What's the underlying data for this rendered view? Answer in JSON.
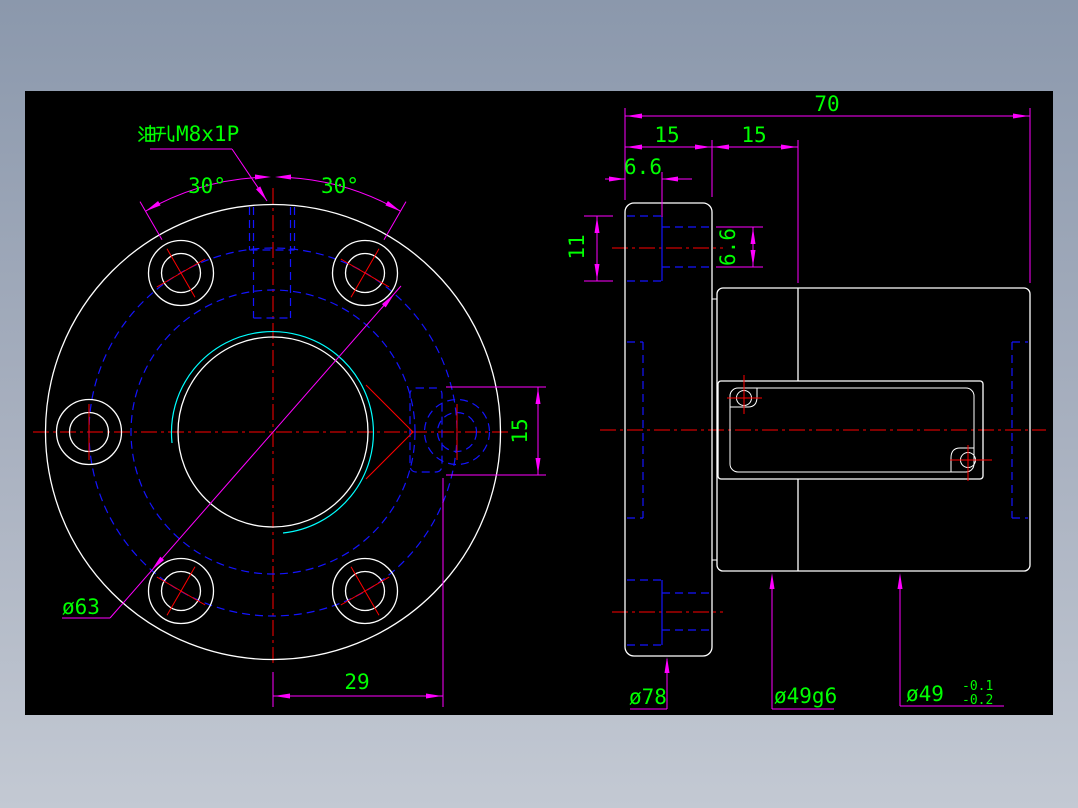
{
  "workspace": {
    "canvas_color": "#000000",
    "desktop_top_color": "#8b98ac",
    "desktop_bottom_color": "#c3c9d3"
  },
  "colors": {
    "geometry": "#ffffff",
    "dimension_lines": "#ff00ff",
    "dimension_text": "#00ff00",
    "hidden_lines": "#1414ff",
    "center_lines": "#ff0000",
    "thread_arc": "#00ffff"
  },
  "front_view": {
    "oil_hole_label": "油孔M8x1P",
    "oil_hole_label_latin": "M8x1P",
    "angle_left": "30°",
    "angle_right": "30°",
    "bolt_circle_diameter": "ø63",
    "keyway_offset": "29",
    "keyway_width": "15"
  },
  "side_view": {
    "overall_length": "70",
    "flange_thickness": "15",
    "pilot_length": "15",
    "counterbore_depth": "6.6",
    "counterbore_diameter": "11",
    "bolt_hole_diameter": "6.6",
    "flange_diameter": "ø78",
    "pilot_diameter": "ø49g6",
    "body_diameter": "ø49",
    "body_tolerance_upper": "-0.1",
    "body_tolerance_lower": "-0.2"
  }
}
